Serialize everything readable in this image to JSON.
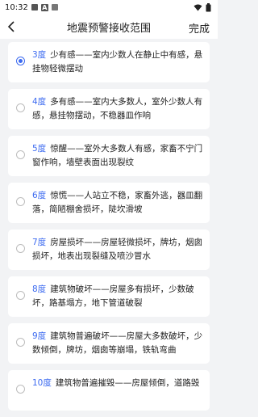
{
  "status_bar": {
    "time": "10:32",
    "icons": [
      "notification-icon",
      "a-icon",
      "box-icon",
      "wifi-icon",
      "battery-icon"
    ],
    "a_label": "A"
  },
  "header": {
    "title": "地震预警接收范围",
    "action_label": "完成",
    "back_icon": "back-chevron-icon"
  },
  "accent_color": "#3d6bf0",
  "items": [
    {
      "degree": "3度",
      "text": "少有感——室内少数人在静止中有感，悬挂物轻微摆动",
      "selected": true
    },
    {
      "degree": "4度",
      "text": "多有感——室内大多数人，室外少数人有感，悬挂物摆动，不稳器皿作响",
      "selected": false
    },
    {
      "degree": "5度",
      "text": "惊醒——室外大多数人有感，家畜不宁门窗作响，墙壁表面出现裂纹",
      "selected": false
    },
    {
      "degree": "6度",
      "text": "惊慌——人站立不稳，家畜外逃，器皿翻落，简陋棚舍损坏，陡坎滑坡",
      "selected": false
    },
    {
      "degree": "7度",
      "text": "房屋损坏——房屋轻微损坏，牌坊，烟囱损坏，地表出现裂缝及喷沙冒水",
      "selected": false
    },
    {
      "degree": "8度",
      "text": "建筑物破坏——房屋多有损坏，少数破坏，路基塌方，地下管道破裂",
      "selected": false
    },
    {
      "degree": "9度",
      "text": "建筑物普遍破坏——房屋大多数破坏，少数倾倒，牌坊，烟囱等崩塌，铁轨弯曲",
      "selected": false
    },
    {
      "degree": "10度",
      "text": "建筑物普遍摧毁——房屋倾倒，道路毁",
      "selected": false
    }
  ]
}
